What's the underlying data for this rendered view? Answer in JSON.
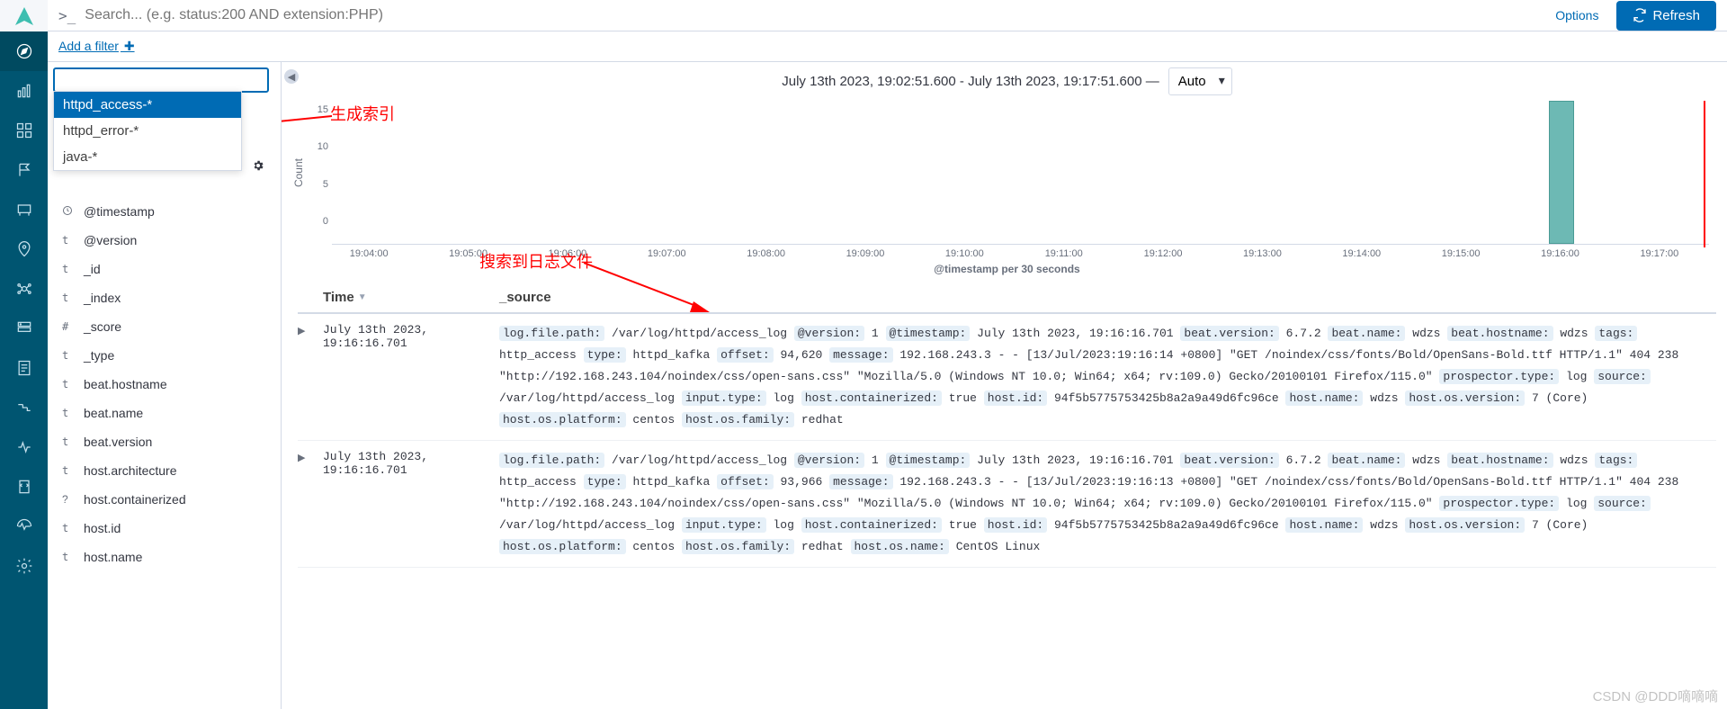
{
  "search": {
    "prompt": ">_",
    "placeholder": "Search... (e.g. status:200 AND extension:PHP)"
  },
  "options_label": "Options",
  "refresh_label": "Refresh",
  "add_filter_label": "Add a filter",
  "index_patterns": [
    "httpd_access-*",
    "httpd_error-*",
    "java-*"
  ],
  "fields": [
    {
      "type": "clock",
      "name": "@timestamp"
    },
    {
      "type": "t",
      "name": "@version"
    },
    {
      "type": "t",
      "name": "_id"
    },
    {
      "type": "t",
      "name": "_index"
    },
    {
      "type": "#",
      "name": "_score"
    },
    {
      "type": "t",
      "name": "_type"
    },
    {
      "type": "t",
      "name": "beat.hostname"
    },
    {
      "type": "t",
      "name": "beat.name"
    },
    {
      "type": "t",
      "name": "beat.version"
    },
    {
      "type": "t",
      "name": "host.architecture"
    },
    {
      "type": "?",
      "name": "host.containerized"
    },
    {
      "type": "t",
      "name": "host.id"
    },
    {
      "type": "t",
      "name": "host.name"
    }
  ],
  "annotations": {
    "gen_index": "生成索引",
    "found_log": "搜索到日志文件"
  },
  "timerange": {
    "text": "July 13th 2023, 19:02:51.600 - July 13th 2023, 19:17:51.600 —",
    "interval": "Auto"
  },
  "chart_data": {
    "type": "bar",
    "title": "",
    "ylabel": "Count",
    "xlabel": "@timestamp per 30 seconds",
    "ylim": [
      0,
      17
    ],
    "yticks": [
      0,
      5,
      10,
      15
    ],
    "categories": [
      "19:04:00",
      "19:05:00",
      "19:06:00",
      "19:07:00",
      "19:08:00",
      "19:09:00",
      "19:10:00",
      "19:11:00",
      "19:12:00",
      "19:13:00",
      "19:14:00",
      "19:15:00",
      "19:16:00",
      "19:17:00"
    ],
    "series": [
      {
        "name": "Count",
        "values": [
          0,
          0,
          0,
          0,
          0,
          0,
          0,
          0,
          0,
          0,
          0,
          0,
          17,
          0
        ]
      }
    ]
  },
  "columns": {
    "time": "Time",
    "source": "_source"
  },
  "rows": [
    {
      "time": "July 13th 2023, 19:16:16.701",
      "kv": [
        [
          "log.file.path:",
          "/var/log/httpd/access_log"
        ],
        [
          "@version:",
          "1"
        ],
        [
          "@timestamp:",
          "July 13th 2023, 19:16:16.701"
        ],
        [
          "beat.version:",
          "6.7.2"
        ],
        [
          "beat.name:",
          "wdzs"
        ],
        [
          "beat.hostname:",
          "wdzs"
        ],
        [
          "tags:",
          "http_access"
        ],
        [
          "type:",
          "httpd_kafka"
        ],
        [
          "offset:",
          "94,620"
        ],
        [
          "message:",
          "192.168.243.3 - - [13/Jul/2023:19:16:14 +0800] \"GET /noindex/css/fonts/Bold/OpenSans-Bold.ttf HTTP/1.1\" 404 238 \"http://192.168.243.104/noindex/css/open-sans.css\" \"Mozilla/5.0 (Windows NT 10.0; Win64; x64; rv:109.0) Gecko/20100101 Firefox/115.0\""
        ],
        [
          "prospector.type:",
          "log"
        ],
        [
          "source:",
          "/var/log/httpd/access_log"
        ],
        [
          "input.type:",
          "log"
        ],
        [
          "host.containerized:",
          "true"
        ],
        [
          "host.id:",
          "94f5b5775753425b8a2a9a49d6fc96ce"
        ],
        [
          "host.name:",
          "wdzs"
        ],
        [
          "host.os.version:",
          "7 (Core)"
        ],
        [
          "host.os.platform:",
          "centos"
        ],
        [
          "host.os.family:",
          "redhat"
        ]
      ]
    },
    {
      "time": "July 13th 2023, 19:16:16.701",
      "kv": [
        [
          "log.file.path:",
          "/var/log/httpd/access_log"
        ],
        [
          "@version:",
          "1"
        ],
        [
          "@timestamp:",
          "July 13th 2023, 19:16:16.701"
        ],
        [
          "beat.version:",
          "6.7.2"
        ],
        [
          "beat.name:",
          "wdzs"
        ],
        [
          "beat.hostname:",
          "wdzs"
        ],
        [
          "tags:",
          "http_access"
        ],
        [
          "type:",
          "httpd_kafka"
        ],
        [
          "offset:",
          "93,966"
        ],
        [
          "message:",
          "192.168.243.3 - - [13/Jul/2023:19:16:13 +0800] \"GET /noindex/css/fonts/Bold/OpenSans-Bold.ttf HTTP/1.1\" 404 238 \"http://192.168.243.104/noindex/css/open-sans.css\" \"Mozilla/5.0 (Windows NT 10.0; Win64; x64; rv:109.0) Gecko/20100101 Firefox/115.0\""
        ],
        [
          "prospector.type:",
          "log"
        ],
        [
          "source:",
          "/var/log/httpd/access_log"
        ],
        [
          "input.type:",
          "log"
        ],
        [
          "host.containerized:",
          "true"
        ],
        [
          "host.id:",
          "94f5b5775753425b8a2a9a49d6fc96ce"
        ],
        [
          "host.name:",
          "wdzs"
        ],
        [
          "host.os.version:",
          "7 (Core)"
        ],
        [
          "host.os.platform:",
          "centos"
        ],
        [
          "host.os.family:",
          "redhat"
        ],
        [
          "host.os.name:",
          "CentOS Linux"
        ]
      ]
    }
  ],
  "watermark": "CSDN @DDD嘀嘀嘀"
}
